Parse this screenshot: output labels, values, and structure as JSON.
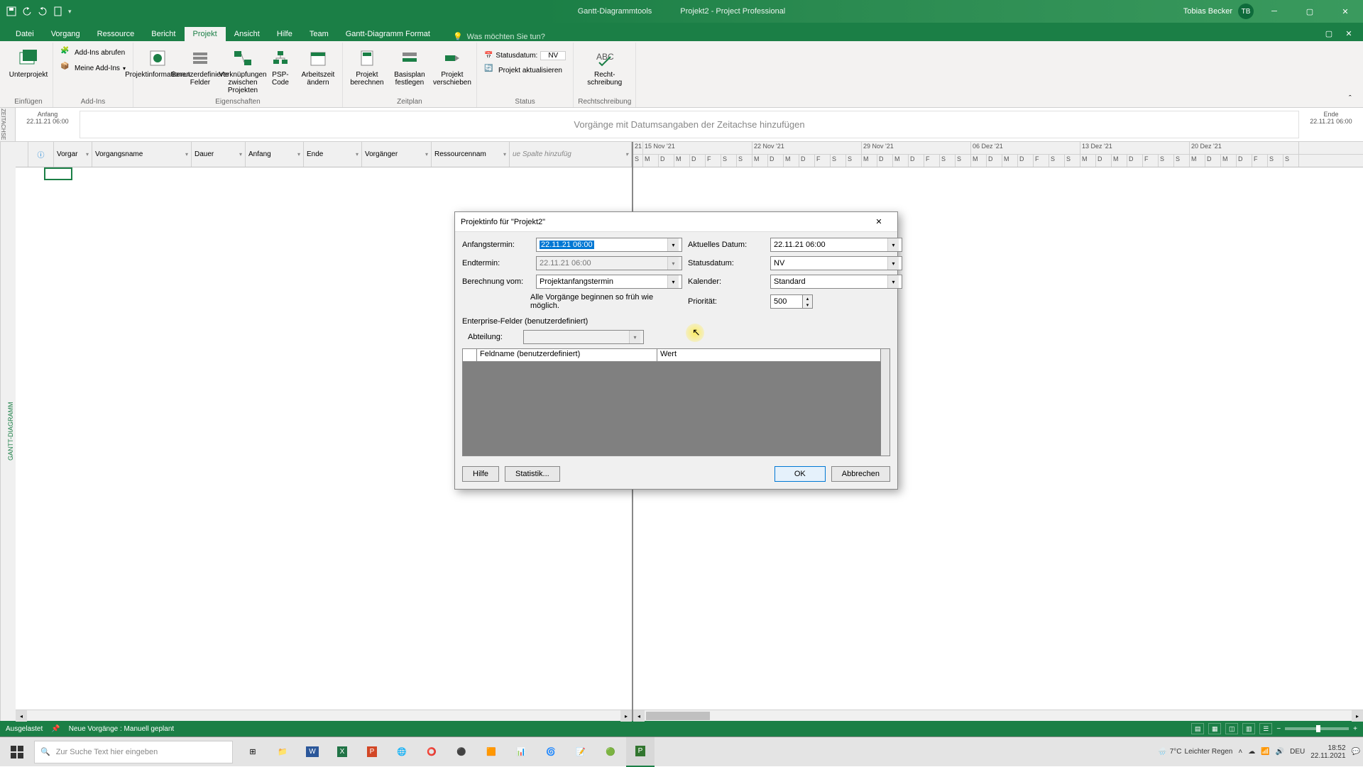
{
  "titlebar": {
    "tools_context": "Gantt-Diagrammtools",
    "doc_title": "Projekt2 - Project Professional",
    "user": "Tobias Becker",
    "initials": "TB"
  },
  "ribbon_tabs": [
    "Datei",
    "Vorgang",
    "Ressource",
    "Bericht",
    "Projekt",
    "Ansicht",
    "Hilfe",
    "Team",
    "Gantt-Diagramm Format"
  ],
  "ribbon_tabs_active": "Projekt",
  "tell_me": "Was möchten Sie tun?",
  "ribbon": {
    "g1": {
      "large": "Unterprojekt",
      "label": "Einfügen"
    },
    "g2": {
      "btn1": "Add-Ins abrufen",
      "btn2": "Meine Add-Ins",
      "label": "Add-Ins"
    },
    "g3": {
      "b1": "Projektinformationen",
      "b2": "Benutzerdefinierte\nFelder",
      "b3": "Verknüpfungen\nzwischen Projekten",
      "b4": "PSP-\nCode",
      "b5": "Arbeitszeit\nändern",
      "label": "Eigenschaften"
    },
    "g4": {
      "b1": "Projekt\nberechnen",
      "b2": "Basisplan\nfestlegen",
      "b3": "Projekt\nverschieben",
      "label": "Zeitplan"
    },
    "g5": {
      "s1": "Statusdatum:",
      "s1v": "NV",
      "s2": "Projekt aktualisieren",
      "label": "Status"
    },
    "g6": {
      "b1": "Recht-\nschreibung",
      "label": "Rechtschreibung"
    }
  },
  "timeline": {
    "start_label": "Anfang",
    "start_date": "22.11.21 06:00",
    "body": "Vorgänge mit Datumsangaben der Zeitachse hinzufügen",
    "end_label": "Ende",
    "end_date": "22.11.21 06:00",
    "side": "ZEITACHSE"
  },
  "grid": {
    "side": "GANTT-DIAGRAMM",
    "cols": [
      "",
      "",
      "Vorgar",
      "Vorgangsname",
      "Dauer",
      "Anfang",
      "Ende",
      "Vorgänger",
      "Ressourcennam",
      "ue Spalte hinzufüg"
    ]
  },
  "gantt": {
    "weeks": [
      "21",
      "15 Nov '21",
      "22 Nov '21",
      "29 Nov '21",
      "06 Dez '21",
      "13 Dez '21",
      "20 Dez '21"
    ],
    "days": [
      "M",
      "D",
      "M",
      "D",
      "F",
      "S",
      "S"
    ]
  },
  "statusbar": {
    "left1": "Ausgelastet",
    "left2": "Neue Vorgänge : Manuell geplant"
  },
  "dialog": {
    "title": "Projektinfo für \"Projekt2\"",
    "labels": {
      "anfang": "Anfangstermin:",
      "aktuell": "Aktuelles Datum:",
      "end": "Endtermin:",
      "status": "Statusdatum:",
      "berechnung": "Berechnung vom:",
      "kalender": "Kalender:",
      "note": "Alle Vorgänge beginnen so früh wie möglich.",
      "prioritat": "Priorität:",
      "enterprise": "Enterprise-Felder (benutzerdefiniert)",
      "abteilung": "Abteilung:",
      "col_feld": "Feldname (benutzerdefiniert)",
      "col_wert": "Wert"
    },
    "values": {
      "anfang": "22.11.21 06:00",
      "aktuell": "22.11.21 06:00",
      "end": "22.11.21 06:00",
      "status": "NV",
      "berechnung": "Projektanfangstermin",
      "kalender": "Standard",
      "prioritat": "500"
    },
    "buttons": {
      "hilfe": "Hilfe",
      "statistik": "Statistik...",
      "ok": "OK",
      "abbrechen": "Abbrechen"
    }
  },
  "taskbar": {
    "search_placeholder": "Zur Suche Text hier eingeben",
    "weather_temp": "7°C",
    "weather_text": "Leichter Regen",
    "time": "18:52",
    "date": "22.11.2021"
  }
}
